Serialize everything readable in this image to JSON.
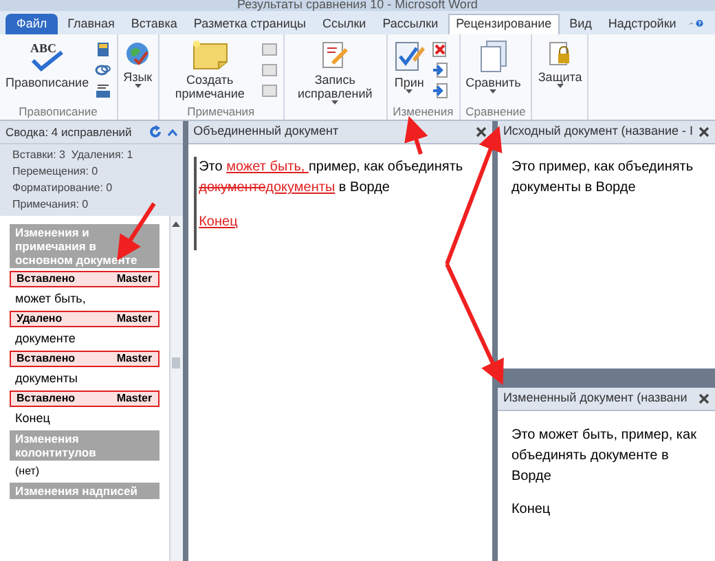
{
  "window": {
    "title": "Результаты сравнения 10 - Microsoft Word"
  },
  "tabs": [
    {
      "label": "Файл",
      "kind": "file",
      "selected": false
    },
    {
      "label": "Главная",
      "kind": "tab",
      "selected": false
    },
    {
      "label": "Вставка",
      "kind": "tab",
      "selected": false
    },
    {
      "label": "Разметка страницы",
      "kind": "tab",
      "selected": false
    },
    {
      "label": "Ссылки",
      "kind": "tab",
      "selected": false
    },
    {
      "label": "Рассылки",
      "kind": "tab",
      "selected": false
    },
    {
      "label": "Рецензирование",
      "kind": "tab",
      "selected": true
    },
    {
      "label": "Вид",
      "kind": "tab",
      "selected": false
    },
    {
      "label": "Надстройки",
      "kind": "tab",
      "selected": false
    }
  ],
  "ribbon": {
    "groups": [
      {
        "label": "Правописание",
        "buttons": [
          {
            "label": "Правописание",
            "icon_text": "ABC",
            "dropdown": false
          }
        ]
      },
      {
        "buttons": [
          {
            "label": "Язык",
            "dropdown": true
          }
        ]
      },
      {
        "label": "Примечания",
        "buttons": [
          {
            "label": "Создать примечание",
            "dropdown": false
          }
        ]
      },
      {
        "buttons": [
          {
            "label": "Запись исправлений",
            "dropdown": true
          }
        ]
      },
      {
        "label": "Изменения",
        "buttons": [
          {
            "label": "Прин",
            "dropdown": true
          }
        ]
      },
      {
        "label": "Сравнение",
        "buttons": [
          {
            "label": "Сравнить",
            "dropdown": true
          }
        ]
      },
      {
        "buttons": [
          {
            "label": "Защита",
            "dropdown": true
          }
        ]
      }
    ]
  },
  "reviewing_pane": {
    "summary": "Сводка: 4 исправлений",
    "stats": [
      "Вставки: 3  Удаления: 1",
      "Перемещения: 0",
      "Форматирование: 0",
      "Примечания: 0"
    ],
    "sections": [
      {
        "title": "Изменения и примечания в основном документе",
        "entries": [
          {
            "type": "Вставлено",
            "author": "Master",
            "text": "может быть,"
          },
          {
            "type": "Удалено",
            "author": "Master",
            "text": "документе"
          },
          {
            "type": "Вставлено",
            "author": "Master",
            "text": "документы"
          },
          {
            "type": "Вставлено",
            "author": "Master",
            "text": "Конец"
          }
        ]
      },
      {
        "title": "Изменения колонтитулов",
        "note": "(нет)"
      },
      {
        "title": "Изменения надписей"
      }
    ]
  },
  "merged_document": {
    "title": "Объединенный документ",
    "paragraphs": [
      [
        {
          "kind": "plain",
          "text": "Это "
        },
        {
          "kind": "inserted",
          "text": "может быть, "
        },
        {
          "kind": "plain",
          "text": "пример, как объединять "
        },
        {
          "kind": "deleted",
          "text": "документе"
        },
        {
          "kind": "inserted",
          "text": "документы"
        },
        {
          "kind": "plain",
          "text": " в Ворде"
        }
      ],
      [
        {
          "kind": "inserted",
          "text": "Конец"
        }
      ]
    ]
  },
  "source_document": {
    "title": "Исходный документ (название - I",
    "paragraphs": [
      "Это пример, как объединять документы в Ворде"
    ]
  },
  "revised_document": {
    "title": "Измененный документ (названи",
    "paragraphs": [
      "Это может быть, пример, как объединять документе в Ворде",
      "Конец"
    ]
  }
}
